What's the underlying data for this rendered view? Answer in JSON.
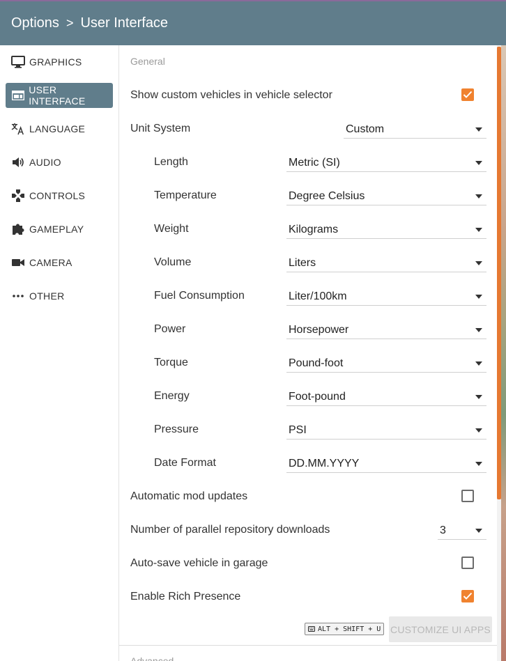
{
  "breadcrumb": {
    "root": "Options",
    "separator": ">",
    "current": "User Interface"
  },
  "sidebar": {
    "items": [
      {
        "label": "GRAPHICS",
        "icon": "monitor-icon",
        "active": false
      },
      {
        "label": "USER INTERFACE",
        "icon": "web-window-icon",
        "active": true
      },
      {
        "label": "LANGUAGE",
        "icon": "translate-icon",
        "active": false
      },
      {
        "label": "AUDIO",
        "icon": "speaker-icon",
        "active": false
      },
      {
        "label": "CONTROLS",
        "icon": "gamepad-icon",
        "active": false
      },
      {
        "label": "GAMEPLAY",
        "icon": "puzzle-icon",
        "active": false
      },
      {
        "label": "CAMERA",
        "icon": "video-camera-icon",
        "active": false
      },
      {
        "label": "OTHER",
        "icon": "more-horizontal-icon",
        "active": false
      }
    ]
  },
  "general": {
    "title": "General",
    "show_custom_vehicles": {
      "label": "Show custom vehicles in vehicle selector",
      "checked": true
    },
    "unit_system": {
      "label": "Unit System",
      "value": "Custom"
    },
    "units": [
      {
        "label": "Length",
        "value": "Metric (SI)"
      },
      {
        "label": "Temperature",
        "value": "Degree Celsius"
      },
      {
        "label": "Weight",
        "value": "Kilograms"
      },
      {
        "label": "Volume",
        "value": "Liters"
      },
      {
        "label": "Fuel Consumption",
        "value": "Liter/100km"
      },
      {
        "label": "Power",
        "value": "Horsepower"
      },
      {
        "label": "Torque",
        "value": "Pound-foot"
      },
      {
        "label": "Energy",
        "value": "Foot-pound"
      },
      {
        "label": "Pressure",
        "value": "PSI"
      },
      {
        "label": "Date Format",
        "value": "DD.MM.YYYY"
      }
    ],
    "auto_mod_updates": {
      "label": "Automatic mod updates",
      "checked": false
    },
    "parallel_downloads": {
      "label": "Number of parallel repository downloads",
      "value": "3"
    },
    "auto_save_vehicle": {
      "label": "Auto-save vehicle in garage",
      "checked": false
    },
    "rich_presence": {
      "label": "Enable Rich Presence",
      "checked": true
    },
    "shortcut": "ALT + SHIFT + U",
    "customize_button": "CUSTOMIZE UI APPS"
  },
  "advanced": {
    "title": "Advanced"
  },
  "colors": {
    "header": "#607d8b",
    "accent": "#f0822f",
    "active_nav": "#607d8b"
  }
}
